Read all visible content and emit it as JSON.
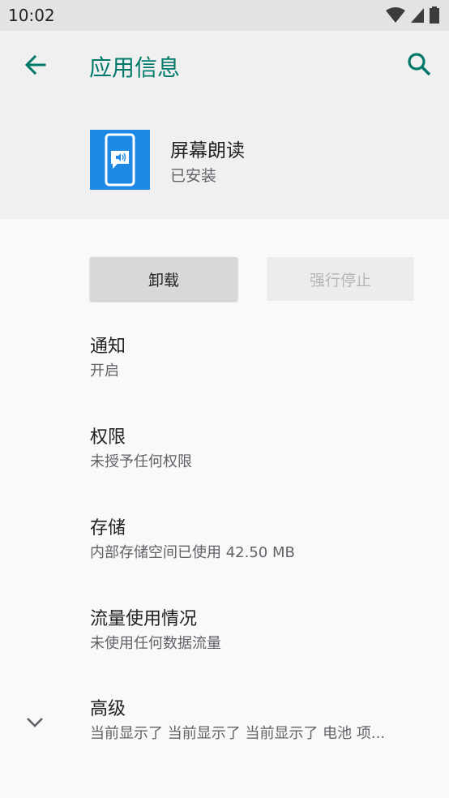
{
  "status_bar": {
    "time": "10:02",
    "icons": [
      "wifi-icon",
      "signal-icon",
      "battery-icon"
    ]
  },
  "header": {
    "title": "应用信息",
    "back_icon": "arrow-back-icon",
    "search_icon": "search-icon",
    "accent_color": "#00796b"
  },
  "app": {
    "name": "屏幕朗读",
    "status": "已安装",
    "icon": "screen-reader-app-icon",
    "icon_color": "#1e88e5"
  },
  "buttons": {
    "uninstall": "卸载",
    "force_stop": "强行停止"
  },
  "settings": [
    {
      "title": "通知",
      "summary": "开启"
    },
    {
      "title": "权限",
      "summary": "未授予任何权限"
    },
    {
      "title": "存储",
      "summary": "内部存储空间已使用 42.50 MB"
    },
    {
      "title": "流量使用情况",
      "summary": "未使用任何数据流量"
    },
    {
      "title": "高级",
      "summary": "当前显示了 当前显示了 当前显示了 电池 项..."
    }
  ]
}
